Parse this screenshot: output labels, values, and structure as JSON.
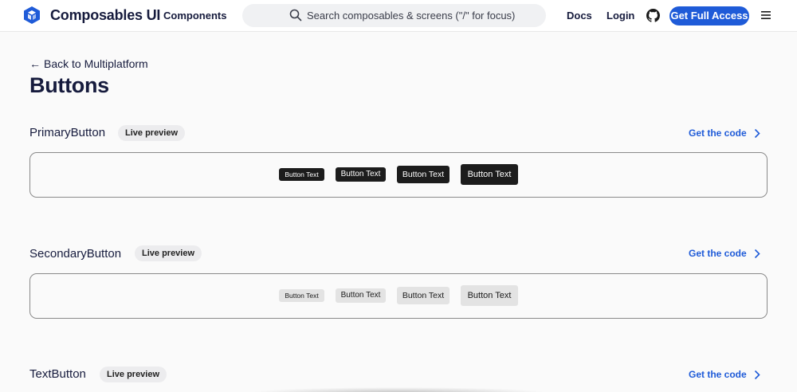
{
  "header": {
    "brand": "Composables UI",
    "nav_components": "Components",
    "search_placeholder": "Search composables & screens (\"/\" for focus)",
    "nav_docs": "Docs",
    "nav_login": "Login",
    "cta_label": "Get Full Access",
    "accent_color": "#1f5bd8"
  },
  "page": {
    "back_label": "Back to Multiplatform",
    "title": "Buttons"
  },
  "sections": [
    {
      "title": "PrimaryButton",
      "badge": "Live preview",
      "get_code": "Get the code",
      "buttons": [
        "Button Text",
        "Button Text",
        "Button Text",
        "Button Text"
      ]
    },
    {
      "title": "SecondaryButton",
      "badge": "Live preview",
      "get_code": "Get the code",
      "buttons": [
        "Button Text",
        "Button Text",
        "Button Text",
        "Button Text"
      ]
    },
    {
      "title": "TextButton",
      "badge": "Live preview",
      "get_code": "Get the code"
    }
  ]
}
